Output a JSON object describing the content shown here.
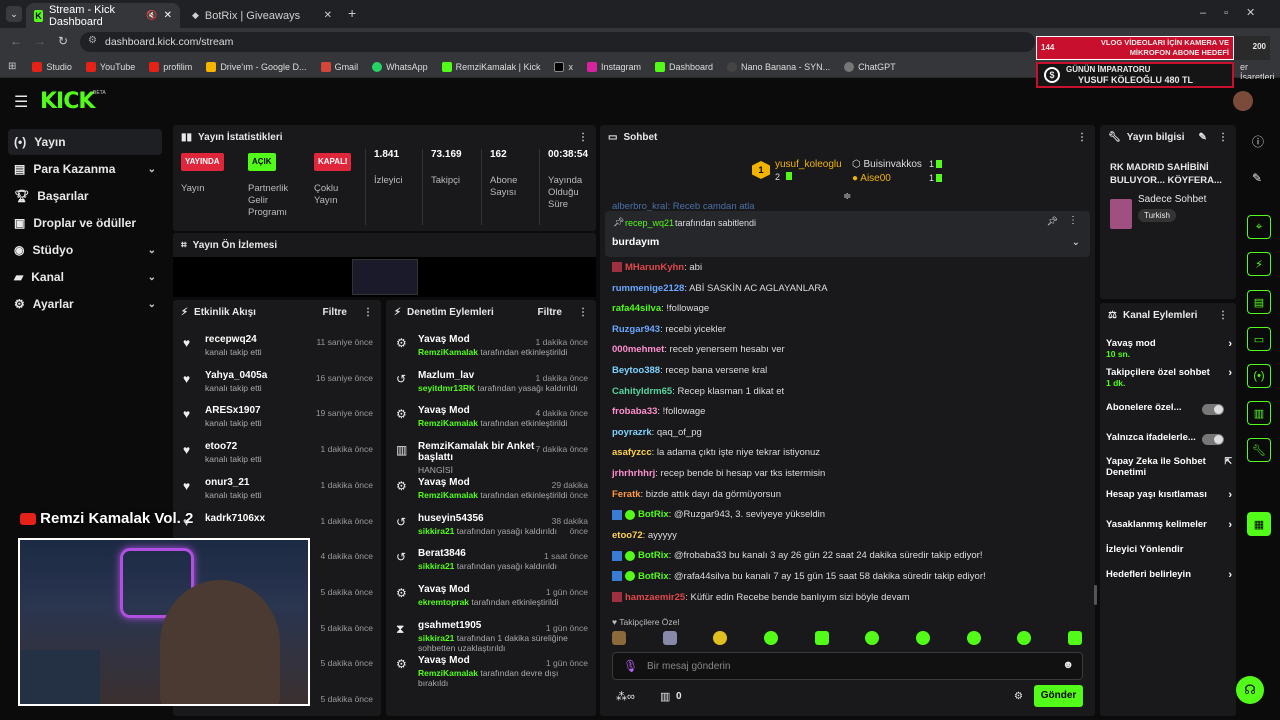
{
  "browser": {
    "tab1": "Stream - Kick Dashboard",
    "tab2": "BotRix | Giveaways",
    "url": "dashboard.kick.com/stream",
    "bookmarks": [
      "Studio",
      "YouTube",
      "profilim",
      "Drive'ım - Google D...",
      "Gmail",
      "WhatsApp",
      "RemziKamalak | Kick",
      "x",
      "Instagram",
      "Dashboard",
      "Nano Banana - SYN...",
      "ChatGPT"
    ],
    "bookmarks_right": "er İşaretleri"
  },
  "overlay": {
    "count_left": "144",
    "title1": "VLOG VİDEOLARI İÇİN KAMERA VE",
    "title2": "MİKROFON ABONE HEDEFİ",
    "count_right": "200",
    "emperor_title": "GÜNÜN İMPARATORU",
    "emperor_name": "YUSUF KÖLEOĞLU 480 TL",
    "channel": "Remzi Kamalak Vol. 2"
  },
  "logo": "KICK",
  "logo_beta": "BETA",
  "sidebar": [
    {
      "label": "Yayın",
      "chev": ""
    },
    {
      "label": "Para Kazanma",
      "chev": "⌄"
    },
    {
      "label": "Başarılar",
      "chev": ""
    },
    {
      "label": "Droplar ve ödüller",
      "chev": ""
    },
    {
      "label": "Stüdyo",
      "chev": "⌄"
    },
    {
      "label": "Kanal",
      "chev": "⌄"
    },
    {
      "label": "Ayarlar",
      "chev": "⌄"
    }
  ],
  "stats": {
    "title": "Yayın İstatistikleri",
    "badges": [
      "YAYINDA",
      "AÇIK",
      "KAPALI"
    ],
    "labels": [
      "Yayın",
      "Partnerlik Gelir Programı",
      "Çoklu Yayın",
      "İzleyici",
      "Takipçi",
      "Abone Sayısı",
      "Yayında Olduğu Süre"
    ],
    "values": [
      "1.841",
      "73.169",
      "162",
      "00:38:54"
    ]
  },
  "preview": {
    "title": "Yayın Ön İzlemesi"
  },
  "activity": {
    "title": "Etkinlik Akışı",
    "filter": "Filtre",
    "items": [
      {
        "name": "recepwq24",
        "sub": "kanalı takip etti",
        "time": "11 saniye önce"
      },
      {
        "name": "Yahya_0405a",
        "sub": "kanalı takip etti",
        "time": "16 saniye önce"
      },
      {
        "name": "ARESx1907",
        "sub": "kanalı takip etti",
        "time": "19 saniye önce"
      },
      {
        "name": "etoo72",
        "sub": "kanalı takip etti",
        "time": "1 dakika önce"
      },
      {
        "name": "onur3_21",
        "sub": "kanalı takip etti",
        "time": "1 dakika önce"
      },
      {
        "name": "kadrk7106xx",
        "sub": "",
        "time": "1 dakika önce"
      },
      {
        "name": "",
        "sub": "",
        "time": "4 dakika önce"
      },
      {
        "name": "",
        "sub": "",
        "time": "5 dakika önce"
      },
      {
        "name": "",
        "sub": "",
        "time": "5 dakika önce"
      },
      {
        "name": "",
        "sub": "",
        "time": "5 dakika önce"
      },
      {
        "name": "",
        "sub": "kanalı takip etti",
        "time": "5 dakika önce"
      }
    ]
  },
  "moderation": {
    "title": "Denetim Eylemleri",
    "filter": "Filtre",
    "items": [
      {
        "name": "Yavaş Mod",
        "actor": "RemziKamalak",
        "sub": "tarafından etkinleştirildi",
        "time": "1 dakika önce",
        "icon": "⚙"
      },
      {
        "name": "Mazlum_lav",
        "actor": "seyitdmr13RK",
        "sub": "tarafından yasağı kaldırıldı",
        "time": "1 dakika önce",
        "icon": "↺"
      },
      {
        "name": "Yavaş Mod",
        "actor": "RemziKamalak",
        "sub": "tarafından etkinleştirildi",
        "time": "4 dakika önce",
        "icon": "⚙"
      },
      {
        "name": "RemziKamalak bir Anket başlattı",
        "actor": "",
        "sub": "HANGİSİ",
        "time": "7 dakika önce",
        "icon": "▥"
      },
      {
        "name": "Yavaş Mod",
        "actor": "RemziKamalak",
        "sub": "tarafından etkinleştirildi",
        "time": "29 dakika önce",
        "icon": "⚙"
      },
      {
        "name": "huseyin54356",
        "actor": "sikkira21",
        "sub": "tarafından yasağı kaldırıldı",
        "time": "38 dakika önce",
        "icon": "↺"
      },
      {
        "name": "Berat3846",
        "actor": "sikkira21",
        "sub": "tarafından yasağı kaldırıldı",
        "time": "1 saat önce",
        "icon": "↺"
      },
      {
        "name": "Yavaş Mod",
        "actor": "ekremtoprak",
        "sub": "tarafından etkinleştirildi",
        "time": "1 gün önce",
        "icon": "⚙"
      },
      {
        "name": "gsahmet1905",
        "actor": "sikkira21",
        "sub": "tarafından 1 dakika süreliğine sohbetten uzaklaştırıldı",
        "time": "1 gün önce",
        "icon": "⧗"
      },
      {
        "name": "Yavaş Mod",
        "actor": "RemziKamalak",
        "sub": "tarafından devre dışı bırakıldı",
        "time": "1 gün önce",
        "icon": "⚙"
      }
    ]
  },
  "chat": {
    "title": "Sohbet",
    "top1": "yusuf_koleoglu",
    "top1n": "2",
    "top2": "Buisinvakkos",
    "top2n": "1",
    "top3": "Aise00",
    "top3n": "1",
    "rank": "1",
    "partial": "alberbro_kral: Receb camdan atla",
    "pinned_by": "recep_wq21",
    "pinned_suffix": "tarafından sabitlendi",
    "pinned_msg": "burdayım",
    "messages": [
      {
        "u": "MHarunKyhn",
        "c": "#e0474b",
        "t": ": abi"
      },
      {
        "u": "rummenige2128",
        "c": "#6aa7ff",
        "t": ": ABİ SASKİN AC AGLAYANLARA"
      },
      {
        "u": "rafa44silva",
        "c": "#53fc18",
        "t": ": !followage"
      },
      {
        "u": "Ruzgar943",
        "c": "#6aa7ff",
        "t": ": recebi yicekler"
      },
      {
        "u": "000mehmet",
        "c": "#ff8fd0",
        "t": ": receb yenersem hesabı ver"
      },
      {
        "u": "Beytoo388",
        "c": "#7fd3ff",
        "t": ": recep bana versene kral"
      },
      {
        "u": "Cahityldrm65",
        "c": "#53d6a0",
        "t": ": Recep klasman 1 dikat et"
      },
      {
        "u": "frobaba33",
        "c": "#ff8fd0",
        "t": ": !followage"
      },
      {
        "u": "poyrazrk",
        "c": "#7fd3ff",
        "t": ": qaq_of_pg"
      },
      {
        "u": "asafyzcc",
        "c": "#ffd24a",
        "t": ": la adama çıktı işte niye tekrar istiyonuz"
      },
      {
        "u": "jrhrhrhhrj",
        "c": "#ff8fd0",
        "t": ": recep bende bi hesap var tks istermisin"
      },
      {
        "u": "Feratk",
        "c": "#ff9a3c",
        "t": ": bizde attık dayı da görmüyorsun"
      },
      {
        "u": "BotRix",
        "c": "#53fc18",
        "t": ": @Ruzgar943, 3. seviyeye yükseldin"
      },
      {
        "u": "etoo72",
        "c": "#ffd24a",
        "t": ": ayyyyy"
      },
      {
        "u": "BotRix",
        "c": "#53fc18",
        "t": ": @frobaba33 bu kanalı 3 ay 26 gün 22 saat 24 dakika süredir takip ediyor!"
      },
      {
        "u": "BotRix",
        "c": "#53fc18",
        "t": ": @rafa44silva bu kanalı 7 ay 15 gün 15 saat 58 dakika süredir takip ediyor!"
      },
      {
        "u": "hamzaemir25",
        "c": "#e0474b",
        "t": ": Küfür edin Recebe bende banlıyım sizi böyle devam"
      }
    ],
    "emote_label": "Takipçilere Özel",
    "placeholder": "Bir mesaj gönderin",
    "points": "0",
    "send": "Gönder"
  },
  "info": {
    "title": "Yayın bilgisi",
    "stream_title": "RK MADRID SAHİBİNİ BULUYOR... KÖYFERA...",
    "category": "Sadece Sohbet",
    "tag": "Turkish"
  },
  "actions": {
    "title": "Kanal Eylemleri",
    "items": [
      {
        "label": "Yavaş mod",
        "sub": "10 sn.",
        "type": "arrow"
      },
      {
        "label": "Takipçilere özel sohbet",
        "sub": "1 dk.",
        "type": "arrow"
      },
      {
        "label": "Abonelere özel...",
        "sub": "",
        "type": "toggle"
      },
      {
        "label": "Yalnızca ifadelerle...",
        "sub": "",
        "type": "toggle"
      },
      {
        "label": "Yapay Zeka ile Sohbet Denetimi",
        "sub": "",
        "type": "ext"
      },
      {
        "label": "Hesap yaşı kısıtlaması",
        "sub": "",
        "type": "arrow"
      },
      {
        "label": "Yasaklanmış kelimeler",
        "sub": "",
        "type": "arrow"
      },
      {
        "label": "İzleyici Yönlendir",
        "sub": "",
        "type": "none"
      },
      {
        "label": "Hedefleri belirleyin",
        "sub": "",
        "type": "arrow"
      }
    ]
  },
  "colors": {
    "accent": "#53fc18",
    "panel": "#19191b",
    "bg": "#0b0b0c"
  }
}
